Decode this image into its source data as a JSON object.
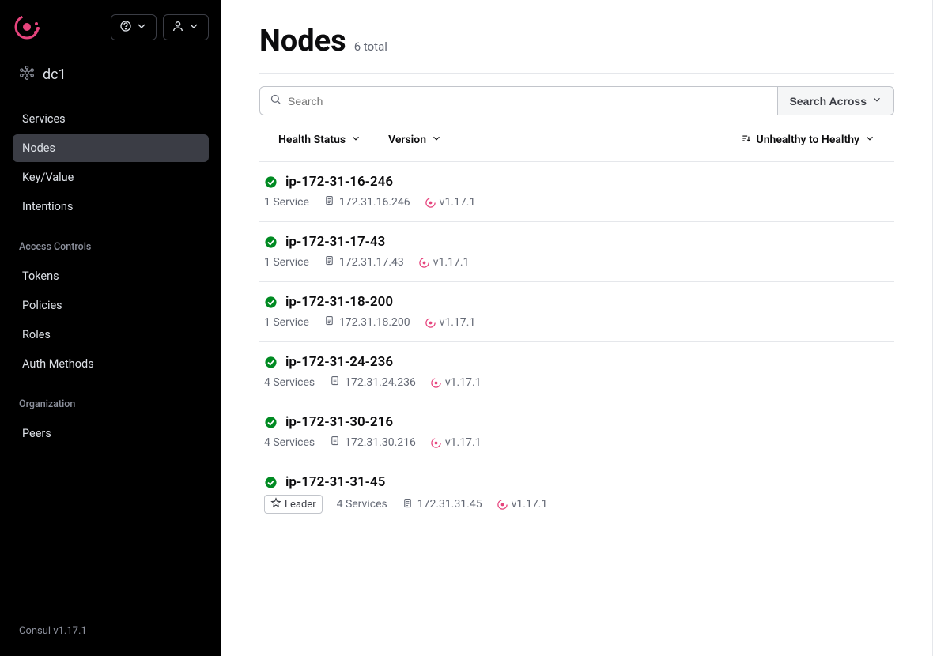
{
  "datacenter": "dc1",
  "sidebar": {
    "main": [
      {
        "label": "Services",
        "active": false
      },
      {
        "label": "Nodes",
        "active": true
      },
      {
        "label": "Key/Value",
        "active": false
      },
      {
        "label": "Intentions",
        "active": false
      }
    ],
    "access_label": "Access Controls",
    "access": [
      {
        "label": "Tokens"
      },
      {
        "label": "Policies"
      },
      {
        "label": "Roles"
      },
      {
        "label": "Auth Methods"
      }
    ],
    "org_label": "Organization",
    "org": [
      {
        "label": "Peers"
      }
    ]
  },
  "footer": "Consul v1.17.1",
  "page": {
    "title": "Nodes",
    "subtitle": "6 total"
  },
  "search": {
    "placeholder": "Search",
    "across_label": "Search Across"
  },
  "filters": {
    "health": "Health Status",
    "version": "Version",
    "sort": "Unhealthy to Healthy"
  },
  "nodes": [
    {
      "name": "ip-172-31-16-246",
      "services": "1 Service",
      "ip": "172.31.16.246",
      "version": "v1.17.1",
      "leader": false
    },
    {
      "name": "ip-172-31-17-43",
      "services": "1 Service",
      "ip": "172.31.17.43",
      "version": "v1.17.1",
      "leader": false
    },
    {
      "name": "ip-172-31-18-200",
      "services": "1 Service",
      "ip": "172.31.18.200",
      "version": "v1.17.1",
      "leader": false
    },
    {
      "name": "ip-172-31-24-236",
      "services": "4 Services",
      "ip": "172.31.24.236",
      "version": "v1.17.1",
      "leader": false
    },
    {
      "name": "ip-172-31-30-216",
      "services": "4 Services",
      "ip": "172.31.30.216",
      "version": "v1.17.1",
      "leader": false
    },
    {
      "name": "ip-172-31-31-45",
      "services": "4 Services",
      "ip": "172.31.31.45",
      "version": "v1.17.1",
      "leader": true,
      "leader_label": "Leader"
    }
  ]
}
